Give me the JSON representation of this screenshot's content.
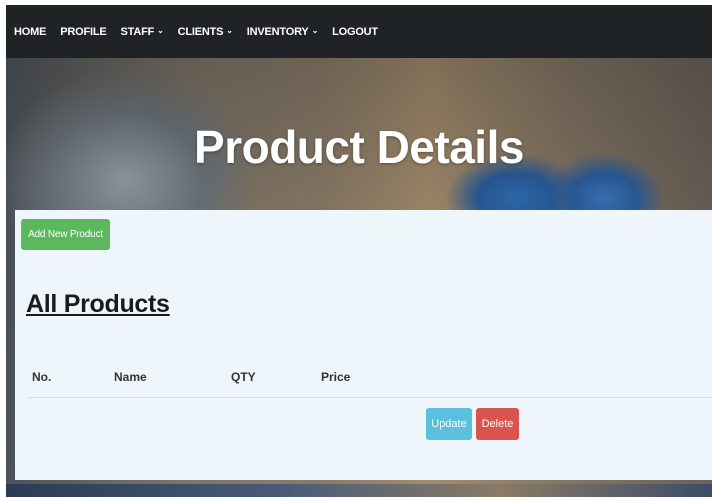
{
  "nav": {
    "items": [
      {
        "label": "HOME",
        "dropdown": false
      },
      {
        "label": "PROFILE",
        "dropdown": false
      },
      {
        "label": "STAFF",
        "dropdown": true
      },
      {
        "label": "CLIENTS",
        "dropdown": true
      },
      {
        "label": "INVENTORY",
        "dropdown": true
      },
      {
        "label": "LOGOUT",
        "dropdown": false
      }
    ],
    "dropdown_icon": "chevron-down-icon"
  },
  "hero": {
    "title": "Product Details"
  },
  "content": {
    "add_button_label": "Add New Product",
    "section_title": "All Products",
    "table": {
      "columns": [
        "No.",
        "Name",
        "QTY",
        "Price"
      ],
      "rows": []
    },
    "update_label": "Update",
    "delete_label": "Delete"
  },
  "colors": {
    "navbar": "#1f2326",
    "panel": "#eef5fb",
    "add_button": "#5cb85c",
    "update_button": "#5bc0de",
    "delete_button": "#d9534f"
  }
}
